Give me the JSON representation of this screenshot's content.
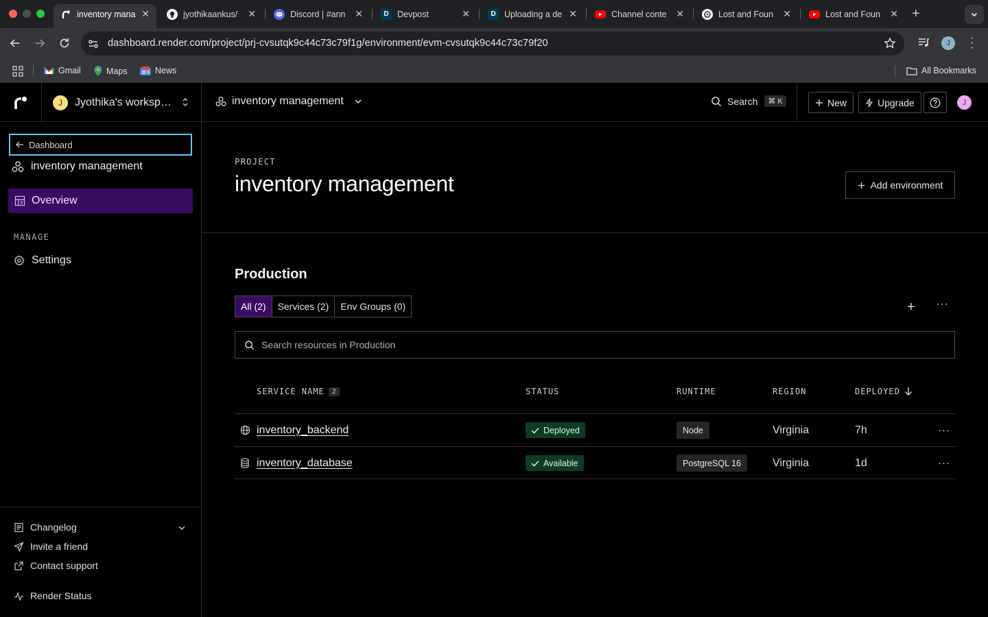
{
  "browser": {
    "tabs": [
      {
        "title": "inventory mana",
        "favicon": "render-icon",
        "active": true
      },
      {
        "title": "jyothikaankus/",
        "favicon": "github-icon"
      },
      {
        "title": "Discord | #ann",
        "favicon": "discord-icon"
      },
      {
        "title": "Devpost",
        "favicon": "devpost-icon"
      },
      {
        "title": "Uploading a de",
        "favicon": "devpost-icon"
      },
      {
        "title": "Channel conte",
        "favicon": "youtube-icon"
      },
      {
        "title": "Lost and Foun",
        "favicon": "openai-icon"
      },
      {
        "title": "Lost and Foun",
        "favicon": "youtube-icon"
      }
    ],
    "url": "dashboard.render.com/project/prj-cvsutqk9c44c73c79f1g/environment/evm-cvsutqk9c44c73c79f20",
    "profile_initial": "J",
    "bookmarks": [
      "Gmail",
      "Maps",
      "News"
    ],
    "all_bookmarks": "All Bookmarks"
  },
  "topbar": {
    "workspace_initial": "J",
    "workspace_name": "Jyothika's workspace",
    "project_name": "inventory management",
    "search_label": "Search",
    "search_shortcut": "⌘ K",
    "new_label": "New",
    "upgrade_label": "Upgrade",
    "user_initial": "J"
  },
  "sidebar": {
    "back_label": "Dashboard",
    "project_name": "inventory management",
    "overview_label": "Overview",
    "manage_heading": "MANAGE",
    "settings_label": "Settings",
    "changelog_label": "Changelog",
    "invite_label": "Invite a friend",
    "support_label": "Contact support",
    "status_label": "Render Status"
  },
  "main": {
    "project_label": "PROJECT",
    "project_title": "inventory management",
    "add_env_label": "Add environment",
    "env_title": "Production",
    "filters": [
      "All (2)",
      "Services (2)",
      "Env Groups (0)"
    ],
    "search_placeholder": "Search resources in Production",
    "table": {
      "headers": {
        "service_name": "SERVICE NAME",
        "service_count": "2",
        "status": "STATUS",
        "runtime": "RUNTIME",
        "region": "REGION",
        "deployed": "DEPLOYED"
      },
      "rows": [
        {
          "name": "inventory_backend",
          "icon": "globe-icon",
          "status": "Deployed",
          "runtime": "Node",
          "region": "Virginia",
          "deployed": "7h"
        },
        {
          "name": "inventory_database",
          "icon": "database-icon",
          "status": "Available",
          "runtime": "PostgreSQL 16",
          "region": "Virginia",
          "deployed": "1d"
        }
      ]
    }
  },
  "colors": {
    "accent_purple": "#3a0b63",
    "status_green": "#0d3b24",
    "focus_blue": "#5ec8f5"
  }
}
